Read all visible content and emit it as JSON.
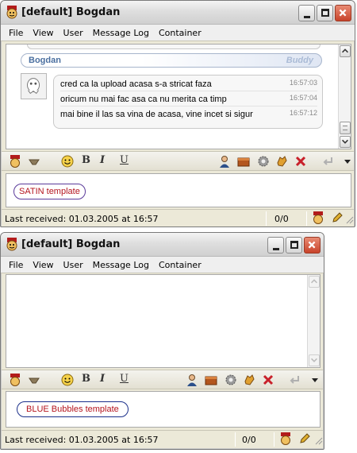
{
  "window1": {
    "title": "[default] Bogdan",
    "menu": [
      {
        "label": "File"
      },
      {
        "label": "View"
      },
      {
        "label": "User"
      },
      {
        "label": "Message Log"
      },
      {
        "label": "Container"
      }
    ],
    "chat": {
      "sender": "Bogdan",
      "group": "Buddy",
      "messages": [
        {
          "text": "cred ca la upload acasa s-a stricat faza",
          "time": "16:57:03"
        },
        {
          "text": "oricum nu mai fac asa ca nu merita ca timp",
          "time": "16:57:04"
        },
        {
          "text": "mai bine il las sa vina de acasa, vine incet si sigur",
          "time": "16:57:12"
        }
      ]
    },
    "template_label": "SATIN template",
    "status": {
      "last_received": "Last received: 01.03.2005 at 16:57",
      "count": "0/0"
    }
  },
  "window2": {
    "title": "[default] Bogdan",
    "menu": [
      {
        "label": "File"
      },
      {
        "label": "View"
      },
      {
        "label": "User"
      },
      {
        "label": "Message Log"
      },
      {
        "label": "Container"
      }
    ],
    "template_label": "BLUE Bubbles template",
    "status": {
      "last_received": "Last received: 01.03.2005 at 16:57",
      "count": "0/0"
    }
  },
  "toolbar_icons": [
    "app-icon",
    "eraser-icon",
    "smiley-icon",
    "bold-icon",
    "italic-icon",
    "underline-icon",
    "user-info-icon",
    "file-transfer-icon",
    "settings-icon",
    "block-icon",
    "close-chat-icon",
    "send-icon",
    "dropdown-icon"
  ],
  "toolbar_text": {
    "bold": "B",
    "italic": "I",
    "underline": "U"
  }
}
